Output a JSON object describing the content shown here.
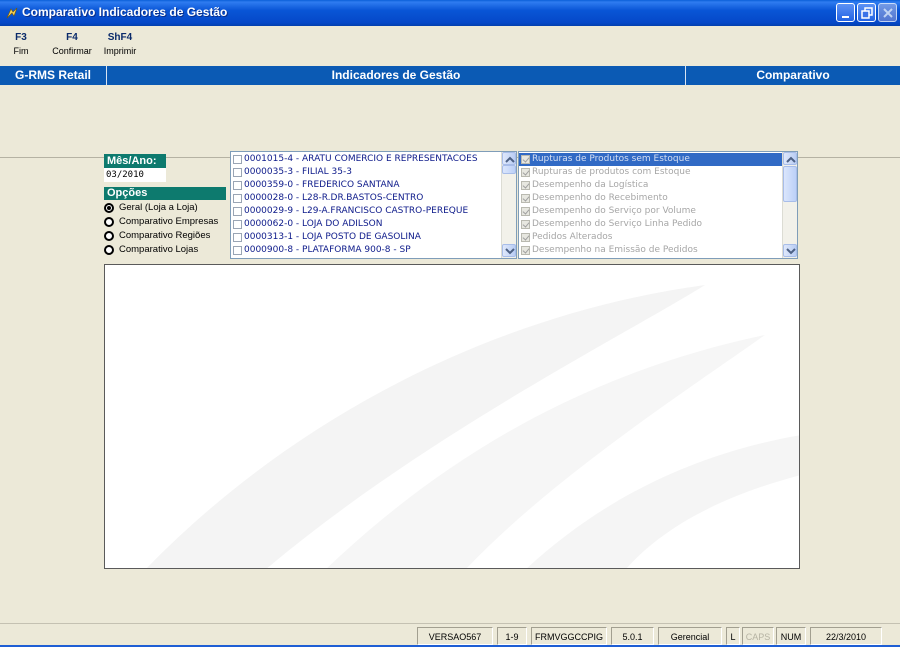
{
  "window": {
    "title": "Comparativo Indicadores de Gestão",
    "icons": [
      "app-icon",
      "minimize-icon",
      "maximize-icon",
      "close-icon"
    ]
  },
  "function_keys": [
    {
      "key": "F3",
      "label": "Fim"
    },
    {
      "key": "F4",
      "label": "Confirmar"
    },
    {
      "key": "ShF4",
      "label": "Imprimir"
    }
  ],
  "header": {
    "app": "G-RMS Retail",
    "module": "Indicadores de Gestão",
    "mode": "Comparativo",
    "color": "#0b5ab4"
  },
  "filters": {
    "mes_ano_label": "Mês/Ano:",
    "mes_ano_value": "03/2010",
    "opcoes_label": "Opções",
    "options": [
      {
        "label": "Geral (Loja a Loja)",
        "selected": true
      },
      {
        "label": "Comparativo Empresas",
        "selected": false
      },
      {
        "label": "Comparativo Regiões",
        "selected": false
      },
      {
        "label": "Comparativo Lojas",
        "selected": false
      }
    ]
  },
  "stores": [
    "0001015-4 - ARATU COMERCIO E REPRESENTACOES",
    "0000035-3 - FILIAL 35-3",
    "0000359-0 - FREDERICO SANTANA",
    "0000028-0 - L28-R.DR.BASTOS-CENTRO",
    "0000029-9 - L29-A.FRANCISCO CASTRO-PEREQUE",
    "0000062-0 - LOJA DO ADILSON",
    "0000313-1 - LOJA POSTO DE GASOLINA",
    "0000900-8 - PLATAFORMA 900-8 - SP"
  ],
  "indicators": [
    {
      "label": "Rupturas de Produtos sem Estoque",
      "selected": true
    },
    {
      "label": "Rupturas de produtos com Estoque",
      "selected": false
    },
    {
      "label": "Desempenho da Logística",
      "selected": false
    },
    {
      "label": "Desempenho do Recebimento",
      "selected": false
    },
    {
      "label": "Desempenho do Serviço por Volume",
      "selected": false
    },
    {
      "label": "Desempenho do Serviço Linha Pedido",
      "selected": false
    },
    {
      "label": "Pedidos Alterados",
      "selected": false
    },
    {
      "label": "Desempenho na Emissão de Pedidos",
      "selected": false
    }
  ],
  "status_bar": [
    {
      "text": "VERSAO567",
      "dim": false
    },
    {
      "text": "1-9",
      "dim": false
    },
    {
      "text": "FRMVGGCCPIG",
      "dim": false
    },
    {
      "text": "5.0.1",
      "dim": false
    },
    {
      "text": "Gerencial",
      "dim": false
    },
    {
      "text": "L",
      "dim": false
    },
    {
      "text": "CAPS",
      "dim": true
    },
    {
      "text": "NUM",
      "dim": false
    },
    {
      "text": "22/3/2010",
      "dim": false
    }
  ]
}
